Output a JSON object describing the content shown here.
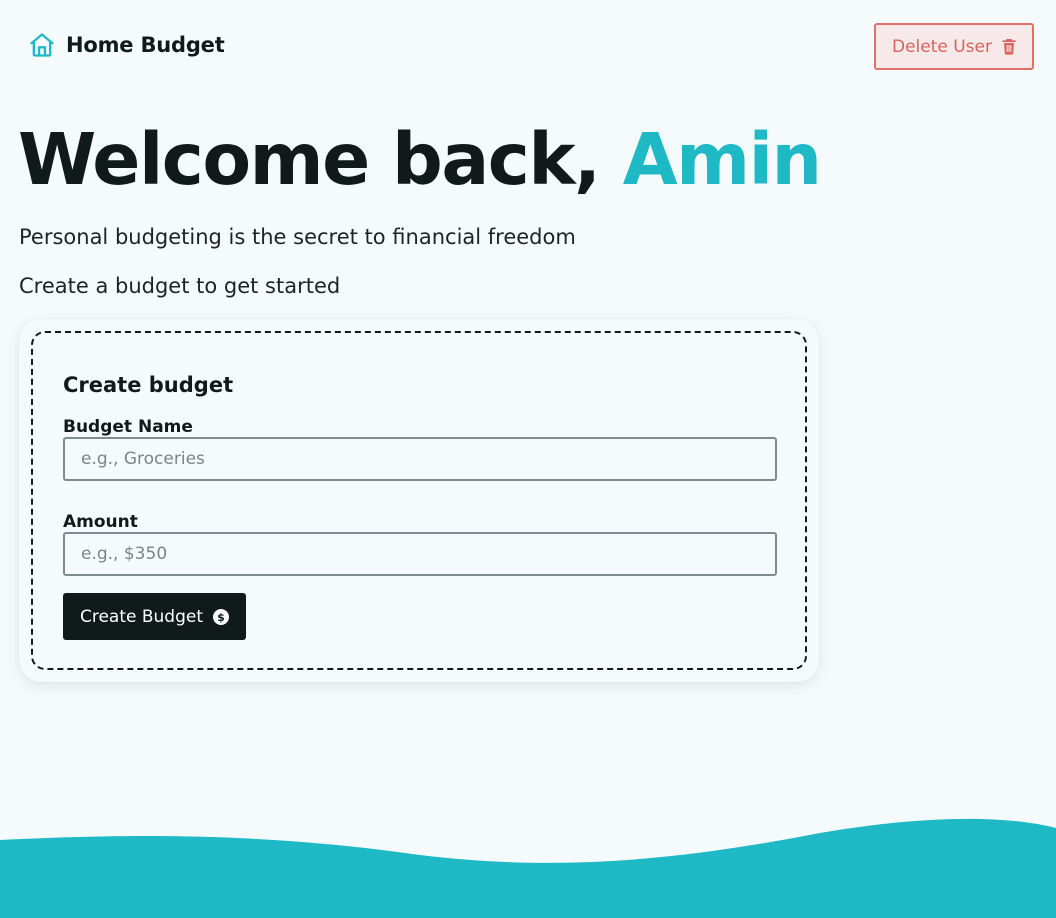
{
  "nav": {
    "brand_label": "Home Budget",
    "brand_icon": "home-icon",
    "delete_label": "Delete User",
    "delete_icon": "trash-icon"
  },
  "hero": {
    "greeting": "Welcome back,",
    "user_name": "Amin",
    "tagline": "Personal budgeting is the secret to financial freedom",
    "prompt": "Create a budget to get started"
  },
  "form": {
    "title": "Create budget",
    "name_label": "Budget Name",
    "name_placeholder": "e.g., Groceries",
    "name_value": "",
    "amount_label": "Amount",
    "amount_placeholder": "e.g., $350",
    "amount_value": "",
    "submit_label": "Create Budget",
    "submit_icon": "dollar-circle-icon"
  },
  "colors": {
    "accent": "#1eb9c5",
    "text": "#111a1b",
    "background": "#f5fbfc",
    "danger": "#d9635c",
    "danger_bg": "#f7e9e9"
  }
}
